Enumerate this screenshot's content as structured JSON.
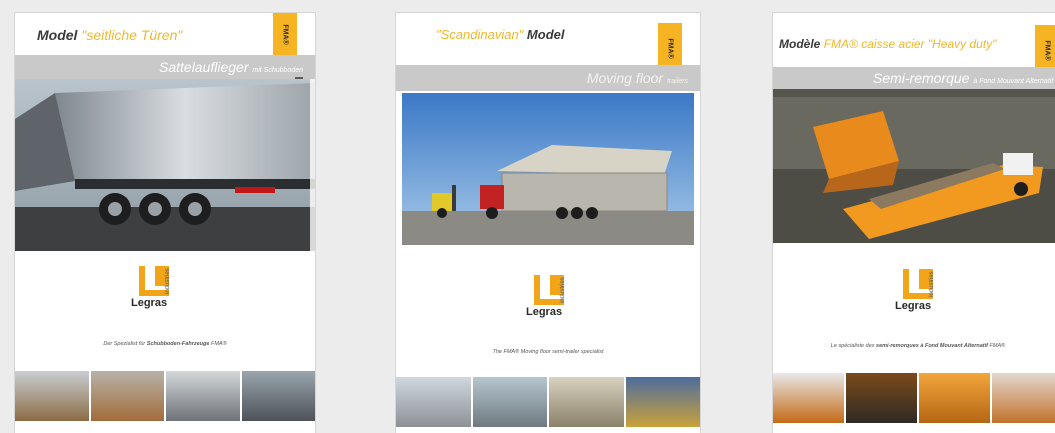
{
  "brochures": [
    {
      "title_main": "Model",
      "title_accent": "\"seitliche Türen\"",
      "tab_label": "FMA®",
      "subtitle_main": "Sattelauflieger",
      "subtitle_small": "mit Schubboden",
      "brand": "Legras",
      "brand_sub": "industries",
      "tagline_pre": "Der Spezialist für",
      "tagline_bold": "Schubboden-Fahrzeuge",
      "tagline_post": "FMA®"
    },
    {
      "title_accent": "\"Scandinavian\"",
      "title_main": "Model",
      "tab_label": "FMA®",
      "subtitle_main": "Moving floor",
      "subtitle_small": "trailers",
      "brand": "Legras",
      "brand_sub": "industries",
      "tagline": "The FMA® Moving floor semi-trailer specialist"
    },
    {
      "title_main": "Modèle",
      "title_accent": "FMA® caisse acier \"Heavy duty\"",
      "tab_label": "FMA®",
      "subtitle_main": "Semi-remorque",
      "subtitle_small": "à Fond Mouvant Alternatif",
      "brand": "Legras",
      "brand_sub": "industries",
      "tagline_pre": "Le spécialiste des",
      "tagline_bold": "semi-remorques à Fond Mouvant Alternatif",
      "tagline_post": "FMA®"
    }
  ]
}
